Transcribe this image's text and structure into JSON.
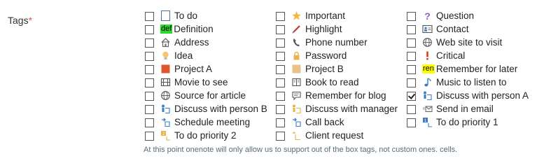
{
  "field": {
    "label": "Tags",
    "required_mark": "*"
  },
  "tags": [
    {
      "label": "To do",
      "icon": "checkbox-outline-icon",
      "checked": false
    },
    {
      "label": "Definition",
      "icon": "def-badge-icon",
      "badge_text": "def",
      "badge_color": "#2fd82f",
      "checked": false
    },
    {
      "label": "Address",
      "icon": "house-icon",
      "checked": false
    },
    {
      "label": "Idea",
      "icon": "lightbulb-icon",
      "checked": false
    },
    {
      "label": "Project A",
      "icon": "square-red-icon",
      "color": "#e0552e",
      "checked": false
    },
    {
      "label": "Movie to see",
      "icon": "film-icon",
      "checked": false
    },
    {
      "label": "Source for article",
      "icon": "globe-icon",
      "checked": false
    },
    {
      "label": "Discuss with person B",
      "icon": "person-b-icon",
      "checked": false
    },
    {
      "label": "Schedule meeting",
      "icon": "schedule-arrow-icon",
      "checked": false
    },
    {
      "label": "To do priority 2",
      "icon": "priority-2-icon",
      "checked": false
    },
    {
      "label": "Important",
      "icon": "star-icon",
      "color": "#f0b94a",
      "checked": false
    },
    {
      "label": "Highlight",
      "icon": "highlighter-icon",
      "checked": false
    },
    {
      "label": "Phone number",
      "icon": "phone-icon",
      "checked": false
    },
    {
      "label": "Password",
      "icon": "padlock-icon",
      "checked": false
    },
    {
      "label": "Project B",
      "icon": "square-tan-icon",
      "color": "#e9c28a",
      "checked": false
    },
    {
      "label": "Book to read",
      "icon": "book-icon",
      "checked": false
    },
    {
      "label": "Remember for blog",
      "icon": "speech-bubble-icon",
      "checked": false
    },
    {
      "label": "Discuss with manager",
      "icon": "person-manager-icon",
      "checked": false
    },
    {
      "label": "Call back",
      "icon": "call-back-arrow-icon",
      "checked": false
    },
    {
      "label": "Client request",
      "icon": "client-bracket-icon",
      "checked": false
    },
    {
      "label": "Question",
      "icon": "question-mark-icon",
      "color": "#8a5fc9",
      "checked": false
    },
    {
      "label": "Contact",
      "icon": "contact-card-icon",
      "checked": false
    },
    {
      "label": "Web site to visit",
      "icon": "globe-icon",
      "checked": false
    },
    {
      "label": "Critical",
      "icon": "exclamation-icon",
      "color": "#e03b1f",
      "checked": false
    },
    {
      "label": "Remember for later",
      "icon": "ren-badge-icon",
      "badge_text": "ren",
      "badge_color": "#ffff00",
      "checked": false
    },
    {
      "label": "Music to listen to",
      "icon": "music-note-icon",
      "checked": false
    },
    {
      "label": "Discuss with person A",
      "icon": "person-a-icon",
      "checked": true
    },
    {
      "label": "Send in email",
      "icon": "envelope-icon",
      "checked": false
    },
    {
      "label": "To do priority 1",
      "icon": "priority-1-icon",
      "checked": false
    }
  ],
  "note": "At this point onenote will only allow us to support out of the box tags, not custom ones. cells."
}
